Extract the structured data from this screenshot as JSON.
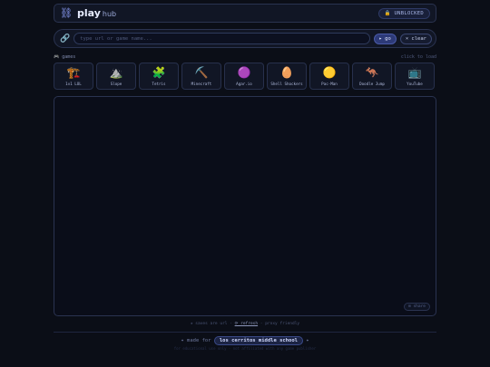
{
  "header": {
    "logo_icon": "link-chain-icon",
    "title": "play",
    "title_sub": "hub",
    "badge": "🔒 UNBLOCKED"
  },
  "search": {
    "placeholder": "type url or game name...",
    "value": "",
    "go_label": "▸ go",
    "clear_label": "× clear"
  },
  "games": {
    "label": "🎮 games",
    "hint": "click to load",
    "items": [
      {
        "name": "1v1 LOL",
        "icon": "🏗️",
        "icon_name": "crane-icon"
      },
      {
        "name": "Slope",
        "icon": "⛰️",
        "icon_name": "mountain-icon"
      },
      {
        "name": "Tetris",
        "icon": "🧩",
        "icon_name": "puzzle-icon"
      },
      {
        "name": "Minecraft",
        "icon": "⛏️",
        "icon_name": "pickaxe-icon"
      },
      {
        "name": "Agar.io",
        "icon": "🟣",
        "icon_name": "purple-circle-icon"
      },
      {
        "name": "Shell Shockers",
        "icon": "🥚",
        "icon_name": "egg-icon"
      },
      {
        "name": "Pac-Man",
        "icon": "🟡",
        "icon_name": "yellow-circle-icon"
      },
      {
        "name": "Doodle Jump",
        "icon": "🦘",
        "icon_name": "kangaroo-icon"
      },
      {
        "name": "YouTube",
        "icon": "📺",
        "icon_name": "television-icon"
      }
    ]
  },
  "frame": {
    "share_label": "⊞ share"
  },
  "footer": {
    "tip_pre": "★ saves are url  ·",
    "tip_refresh": "⟳ refresh",
    "tip_post": "· proxy friendly",
    "made_for": "✦ made for",
    "school": "los cerritos middle school",
    "made_suffix": "✦",
    "fine_print": "for educational use only · not affiliated with any game publisher"
  },
  "colors": {
    "background": "#0b0e17",
    "accent": "#8fa2ff",
    "border": "#2a3350",
    "panel": "#111625"
  }
}
